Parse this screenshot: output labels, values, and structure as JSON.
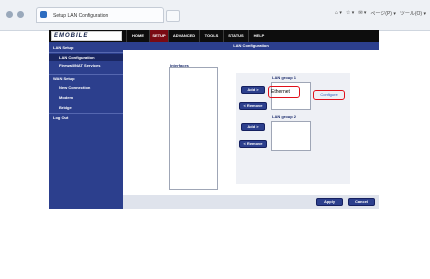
{
  "browser": {
    "tab_title": "Setup LAN Configuration",
    "toolbar_items": [
      "⌂ ▾",
      "☆ ▾",
      "✉ ▾",
      "ページ(P) ▾",
      "ツール(O) ▾"
    ]
  },
  "router": {
    "logo_text": "EMOBILE",
    "nav": [
      {
        "label": "HOME"
      },
      {
        "label": "SETUP"
      },
      {
        "label": "ADVANCED"
      },
      {
        "label": "TOOLS"
      },
      {
        "label": "STATUS"
      },
      {
        "label": "HELP"
      }
    ],
    "sidebar": [
      {
        "label": "LAN Setup"
      },
      {
        "label": "LAN Configuration"
      },
      {
        "label": "Firewall/NAT Services"
      },
      {
        "label": "WAN Setup"
      },
      {
        "label": "New Connection"
      },
      {
        "label": "Modem"
      },
      {
        "label": "Bridge"
      },
      {
        "label": "Log Out"
      }
    ],
    "page_title": "LAN Configuration",
    "interfaces_label": "Interfaces",
    "group1": {
      "label": "LAN group 1",
      "add": "Add >",
      "remove": "< Remove",
      "items": [
        "Ethernet"
      ],
      "configure": "Configure"
    },
    "group2": {
      "label": "LAN group 2",
      "add": "Add >",
      "remove": "< Remove"
    },
    "apply": "Apply",
    "cancel": "Cancel"
  },
  "colors": {
    "sidebar": "#2c3f8d",
    "active_nav": "#7a0a13",
    "highlight": "#e0101a"
  }
}
